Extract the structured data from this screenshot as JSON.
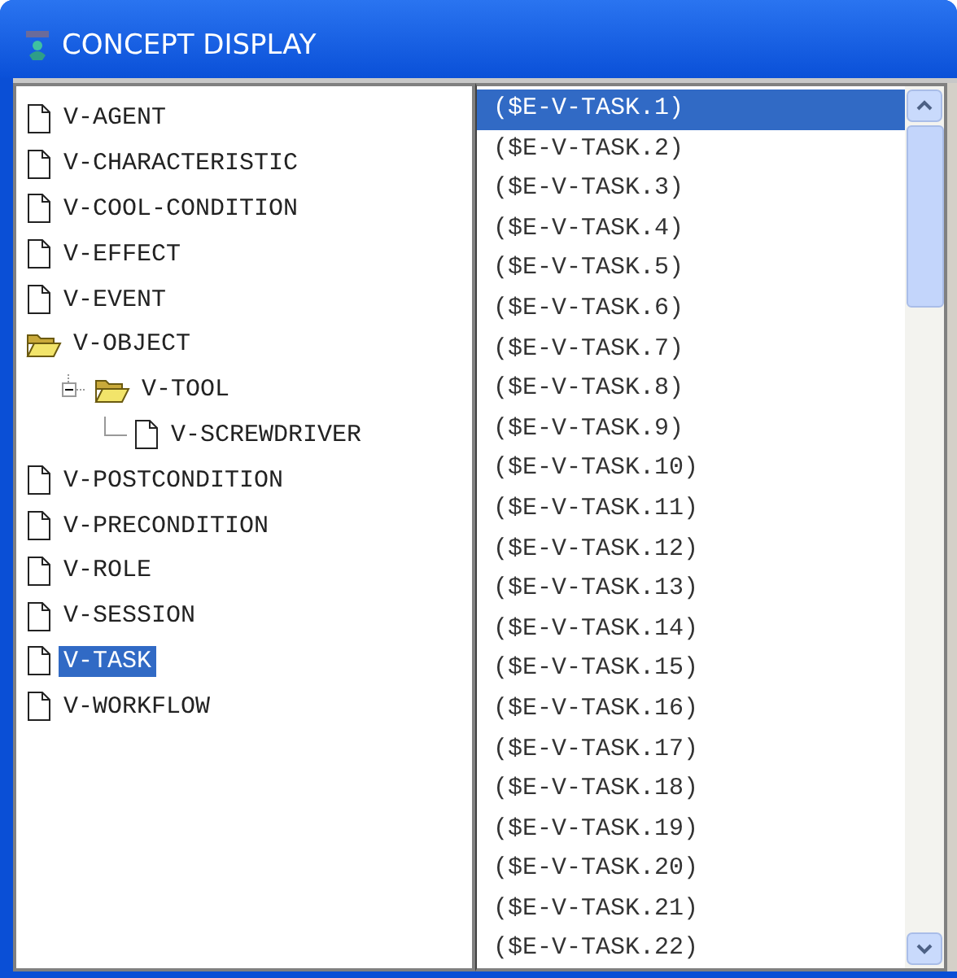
{
  "window": {
    "title": "CONCEPT DISPLAY"
  },
  "tree": [
    {
      "label": "V-AGENT",
      "selected": false
    },
    {
      "label": "V-CHARACTERISTIC",
      "selected": false
    },
    {
      "label": "V-COOL-CONDITION",
      "selected": false
    },
    {
      "label": "V-EFFECT",
      "selected": false
    },
    {
      "label": "V-EVENT",
      "selected": false
    },
    {
      "label": "V-OBJECT",
      "selected": false,
      "expanded": true,
      "children": [
        {
          "label": "V-TOOL",
          "selected": false,
          "expanded": true,
          "children": [
            {
              "label": "V-SCREWDRIVER",
              "selected": false
            }
          ]
        }
      ]
    },
    {
      "label": "V-POSTCONDITION",
      "selected": false
    },
    {
      "label": "V-PRECONDITION",
      "selected": false
    },
    {
      "label": "V-ROLE",
      "selected": false
    },
    {
      "label": "V-SESSION",
      "selected": false
    },
    {
      "label": "V-TASK",
      "selected": true
    },
    {
      "label": "V-WORKFLOW",
      "selected": false
    }
  ],
  "instances": [
    {
      "label": "($E-V-TASK.1)",
      "selected": true
    },
    {
      "label": "($E-V-TASK.2)",
      "selected": false
    },
    {
      "label": "($E-V-TASK.3)",
      "selected": false
    },
    {
      "label": "($E-V-TASK.4)",
      "selected": false
    },
    {
      "label": "($E-V-TASK.5)",
      "selected": false
    },
    {
      "label": "($E-V-TASK.6)",
      "selected": false
    },
    {
      "label": "($E-V-TASK.7)",
      "selected": false
    },
    {
      "label": "($E-V-TASK.8)",
      "selected": false
    },
    {
      "label": "($E-V-TASK.9)",
      "selected": false
    },
    {
      "label": "($E-V-TASK.10)",
      "selected": false
    },
    {
      "label": "($E-V-TASK.11)",
      "selected": false
    },
    {
      "label": "($E-V-TASK.12)",
      "selected": false
    },
    {
      "label": "($E-V-TASK.13)",
      "selected": false
    },
    {
      "label": "($E-V-TASK.14)",
      "selected": false
    },
    {
      "label": "($E-V-TASK.15)",
      "selected": false
    },
    {
      "label": "($E-V-TASK.16)",
      "selected": false
    },
    {
      "label": "($E-V-TASK.17)",
      "selected": false
    },
    {
      "label": "($E-V-TASK.18)",
      "selected": false
    },
    {
      "label": "($E-V-TASK.19)",
      "selected": false
    },
    {
      "label": "($E-V-TASK.20)",
      "selected": false
    },
    {
      "label": "($E-V-TASK.21)",
      "selected": false
    },
    {
      "label": "($E-V-TASK.22)",
      "selected": false
    }
  ]
}
